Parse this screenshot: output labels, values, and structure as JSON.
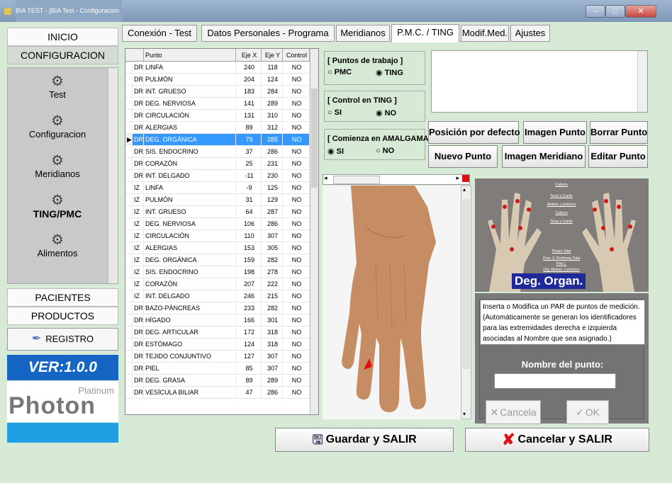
{
  "window": {
    "title": "BIA TEST - [BIA Test - Configuracion"
  },
  "sidebar": {
    "inicio": "INICIO",
    "configuracion": "CONFIGURACION",
    "items": [
      {
        "label": "Test",
        "icon": "gear-icon"
      },
      {
        "label": "Configuracion",
        "icon": "gear-icon"
      },
      {
        "label": "Meridianos",
        "icon": "gear-icon"
      },
      {
        "label": "TING/PMC",
        "icon": "gear-icon"
      },
      {
        "label": "Alimentos",
        "icon": "gear-icon"
      }
    ],
    "pacientes": "PACIENTES",
    "productos": "PRODUCTOS",
    "registro": "REGISTRO",
    "version": "VER:1.0.0",
    "logo_small": "Platinum",
    "logo_big": "Photon"
  },
  "tabs": [
    {
      "label": "Conexión - Test"
    },
    {
      "label": "Datos Personales - Programa"
    },
    {
      "label": "Meridianos"
    },
    {
      "label": "P.M.C. / TING",
      "active": true
    },
    {
      "label": "Modif.Med."
    },
    {
      "label": "Ajustes"
    }
  ],
  "table": {
    "headers": [
      "",
      "Punto",
      "Eje X",
      "Eje Y",
      "Control"
    ],
    "rows": [
      [
        "DR",
        "LINFA",
        "240",
        "118",
        "NO"
      ],
      [
        "DR",
        "PULMÓN",
        "204",
        "124",
        "NO"
      ],
      [
        "DR",
        "INT. GRUESO",
        "183",
        "284",
        "NO"
      ],
      [
        "DR",
        "DEG. NERVIOSA",
        "141",
        "289",
        "NO"
      ],
      [
        "DR",
        "CIRCULACIÓN",
        "131",
        "310",
        "NO"
      ],
      [
        "DR",
        "ALERGIAS",
        "89",
        "312",
        "NO"
      ],
      [
        "DR",
        "DEG. ORGÁNICA",
        "79",
        "285",
        "NO"
      ],
      [
        "DR",
        "SIS. ENDOCRINO",
        "37",
        "286",
        "NO"
      ],
      [
        "DR",
        "CORAZÓN",
        "25",
        "231",
        "NO"
      ],
      [
        "DR",
        "INT. DELGADO",
        "-11",
        "230",
        "NO"
      ],
      [
        "IZ",
        "LINFA",
        "-9",
        "125",
        "NO"
      ],
      [
        "IZ",
        "PULMÓN",
        "31",
        "129",
        "NO"
      ],
      [
        "IZ",
        "INT. GRUESO",
        "64",
        "287",
        "NO"
      ],
      [
        "IZ",
        "DEG. NERVIOSA",
        "106",
        "286",
        "NO"
      ],
      [
        "IZ",
        "CIRCULACIÓN",
        "110",
        "307",
        "NO"
      ],
      [
        "IZ",
        "ALERGIAS",
        "153",
        "305",
        "NO"
      ],
      [
        "IZ",
        "DEG. ORGÁNICA",
        "159",
        "282",
        "NO"
      ],
      [
        "IZ",
        "SIS. ENDOCRINO",
        "198",
        "278",
        "NO"
      ],
      [
        "IZ",
        "CORAZÓN",
        "207",
        "222",
        "NO"
      ],
      [
        "IZ",
        "INT. DELGADO",
        "246",
        "215",
        "NO"
      ],
      [
        "DR",
        "BAZO-PÁNCREAS",
        "233",
        "282",
        "NO"
      ],
      [
        "DR",
        "HÍGADO",
        "166",
        "301",
        "NO"
      ],
      [
        "DR",
        "DEG. ARTICULAR",
        "172",
        "318",
        "NO"
      ],
      [
        "DR",
        "ESTÓMAGO",
        "124",
        "318",
        "NO"
      ],
      [
        "DR",
        "TEJIDO CONJUNTIVO",
        "127",
        "307",
        "NO"
      ],
      [
        "DR",
        "PIEL",
        "85",
        "307",
        "NO"
      ],
      [
        "DR",
        "DEG. GRASA",
        "89",
        "289",
        "NO"
      ],
      [
        "DR",
        "VESÍCULA BILIAR",
        "47",
        "286",
        "NO"
      ]
    ],
    "selected_row": 6
  },
  "options": {
    "puntos_title": "[ Puntos de trabajo ]",
    "pmc": "PMC",
    "ting": "TING",
    "puntos_selected": "TING",
    "control_title": "[ Control en TING ]",
    "si": "SI",
    "no": "NO",
    "control_selected": "NO",
    "amalgamas_title": "[ Comienza en AMALGAMAS",
    "amalgamas_selected": "SI"
  },
  "buttons": {
    "posicion": "Posición por defecto",
    "imagen_punto": "Imagen Punto",
    "borrar_punto": "Borrar Punto",
    "nuevo_punto": "Nuevo Punto",
    "imagen_meridiano": "Imagen Meridiano",
    "editar_punto": "Editar Punto",
    "guardar": "Guardar y SALIR",
    "cancelar": "Cancelar y SALIR"
  },
  "meridian_image": {
    "labels": [
      "Cabeza",
      "Torax y Cuello",
      "Abdom. y pelvicos",
      "Cabeza",
      "Torax y Cuello",
      "Pinaro Total",
      "Prox. 3. Perifonea Total",
      "P.M.C.",
      "Org. Abdom. y pelvicos"
    ],
    "caption": "Deg. Organ."
  },
  "dialog": {
    "text": "Inserta o Modifica un PAR de puntos de medición. (Automáticamente se generan los identificadores para las extremidades derecha e izquierda asociadas al Nombre que sea asignado.)",
    "label": "Nombre del punto:",
    "input_value": "",
    "cancel": "Cancela",
    "ok": "OK"
  },
  "colors": {
    "background": "#d6ead6",
    "selection": "#3399ff",
    "version_bg": "#1565c4",
    "accent_red": "#e01010"
  }
}
